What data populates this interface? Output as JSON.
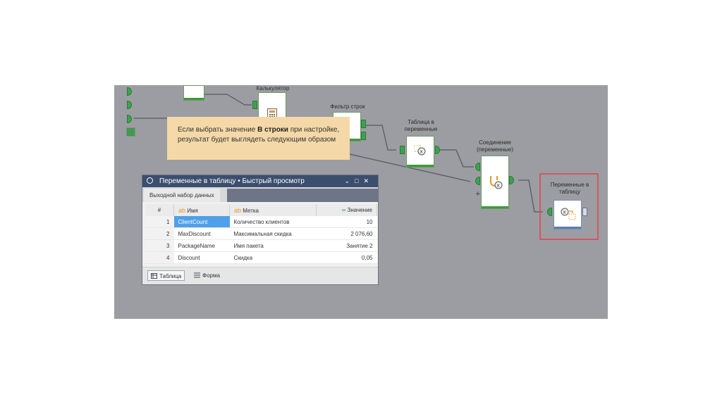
{
  "nodes": {
    "calculator": "Калькулятор",
    "row_filter": "Фильтр строк",
    "table_to_vars": "Таблица в переменные",
    "join_vars": "Соединение (переменные)",
    "vars_to_table": "Переменные в таблицу"
  },
  "callout": {
    "text_before": "Если выбрать значение ",
    "bold": "В строки",
    "text_after": " при настройке, результат будет выглядеть следующим образом"
  },
  "dialog": {
    "title": "Переменные в таблицу • Быстрый просмотр",
    "tab": "Выходной набор данных",
    "columns": {
      "num": "#",
      "name": "Имя",
      "label": "Метка",
      "value": "Значение"
    },
    "rows": [
      {
        "num": "1",
        "name": "ClientCount",
        "label": "Количество клиентов",
        "value": "10"
      },
      {
        "num": "2",
        "name": "MaxDiscount",
        "label": "Максимальная скидка",
        "value": "2 076,60"
      },
      {
        "num": "3",
        "name": "PackageName",
        "label": "Имя пакета",
        "value": "Занятие 2"
      },
      {
        "num": "4",
        "name": "Discount",
        "label": "Скидка",
        "value": "0,05"
      }
    ],
    "footer": {
      "table_button": "Таблица",
      "form_button": "Форма"
    }
  },
  "icons": [
    "search-icon",
    "minimize-icon",
    "maximize-icon",
    "close-icon",
    "table-icon",
    "form-icon",
    "calculator-icon",
    "filter-icon",
    "variable-icon",
    "join-icon"
  ],
  "colors": {
    "canvas": "#9c9da2",
    "callout": "#f4d8a7",
    "title_bar": "#3b4e6e",
    "port_green": "#3fa14f",
    "selection": "#4fa0e8",
    "highlight_red": "#e0424a"
  }
}
